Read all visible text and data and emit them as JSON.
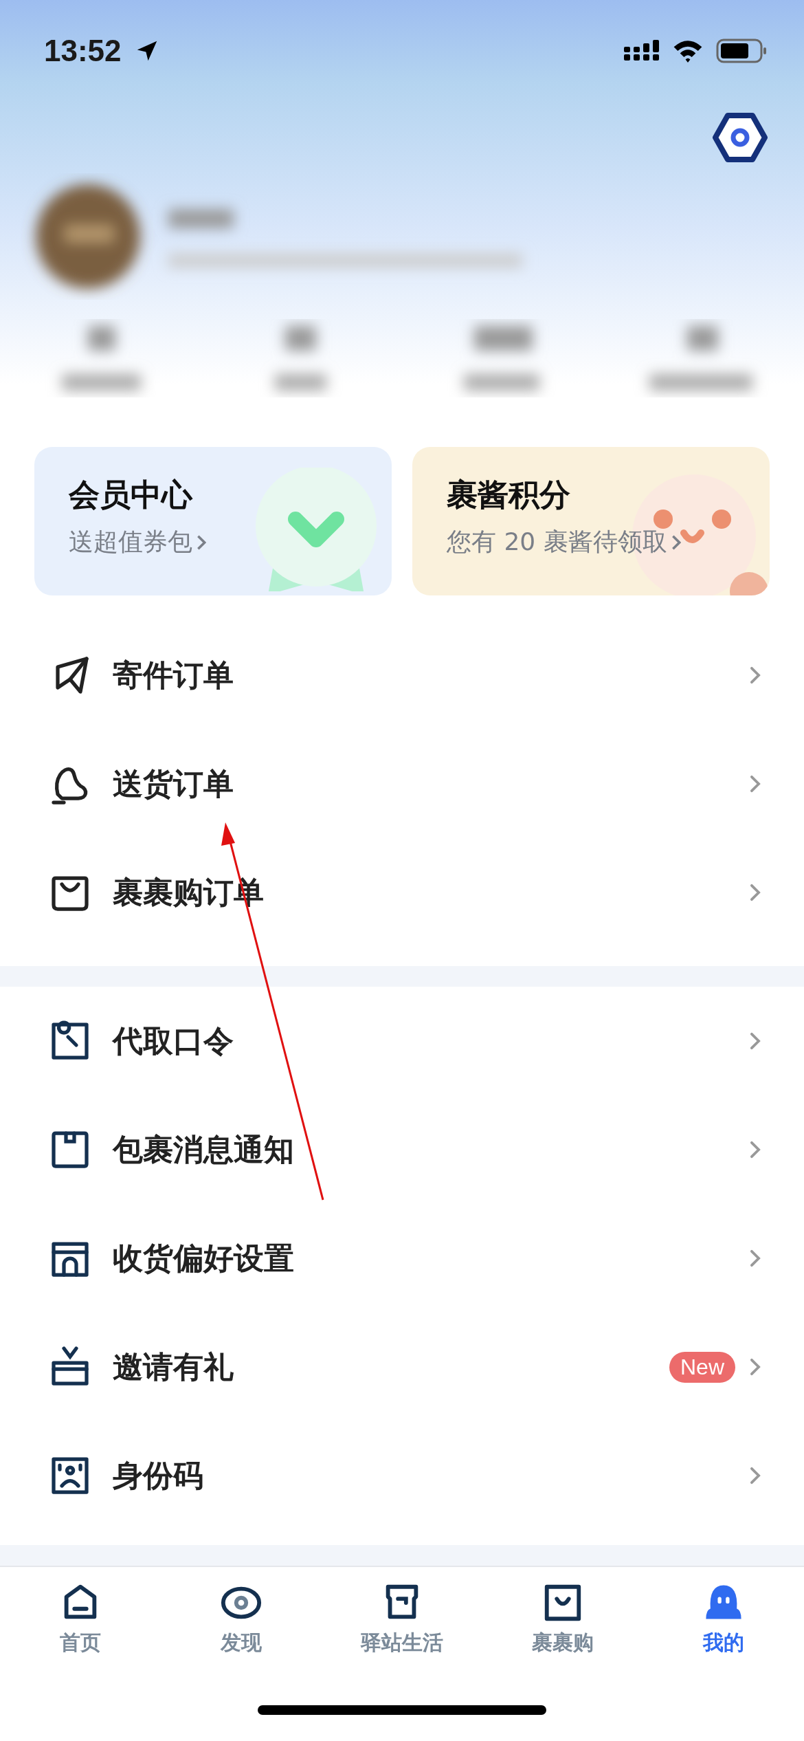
{
  "status_bar": {
    "time": "13:52"
  },
  "cards": [
    {
      "title": "会员中心",
      "subtitle": "送超值券包"
    },
    {
      "title": "裹酱积分",
      "subtitle": "您有 20 裹酱待领取"
    }
  ],
  "menu_sections": [
    {
      "items": [
        {
          "label": "寄件订单"
        },
        {
          "label": "送货订单"
        },
        {
          "label": "裹裹购订单"
        }
      ]
    },
    {
      "items": [
        {
          "label": "代取口令"
        },
        {
          "label": "包裹消息通知"
        },
        {
          "label": "收货偏好设置"
        },
        {
          "label": "邀请有礼",
          "badge": "New"
        },
        {
          "label": "身份码"
        }
      ]
    }
  ],
  "tab_bar": [
    {
      "label": "首页",
      "selected": false
    },
    {
      "label": "发现",
      "selected": false
    },
    {
      "label": "驿站生活",
      "selected": false
    },
    {
      "label": "裹裹购",
      "selected": false
    },
    {
      "label": "我的",
      "selected": true
    }
  ]
}
